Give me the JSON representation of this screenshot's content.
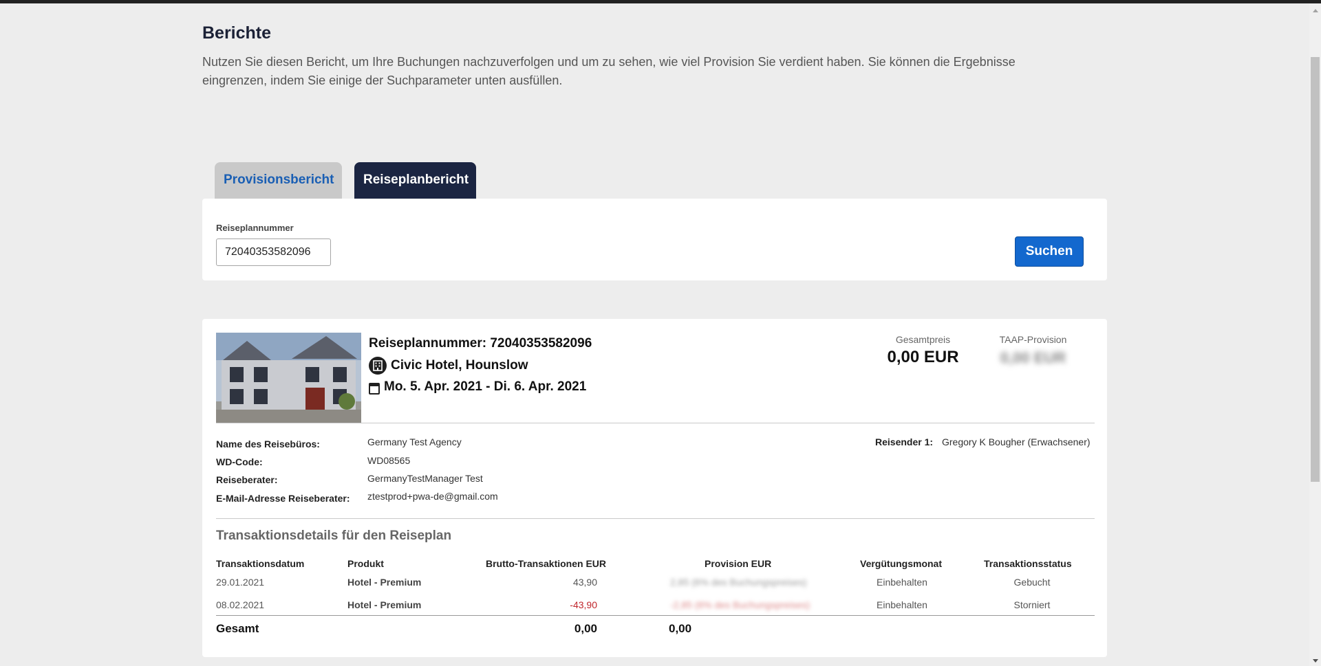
{
  "page": {
    "title": "Berichte",
    "description": "Nutzen Sie diesen Bericht, um Ihre Buchungen nachzuverfolgen und um zu sehen, wie viel Provision Sie verdient haben. Sie können die Ergebnisse eingrenzen, indem Sie einige der Suchparameter unten ausfüllen."
  },
  "tabs": [
    {
      "label": "Provisionsbericht",
      "active": false
    },
    {
      "label": "Reiseplanbericht",
      "active": true
    }
  ],
  "search": {
    "label": "Reiseplannummer",
    "value": "72040353582096",
    "button_label": "Suchen"
  },
  "result": {
    "itinerary_number": "Reiseplannummer: 72040353582096",
    "hotel": "Civic Hotel, Hounslow",
    "dates": "Mo. 5. Apr. 2021 - Di. 6. Apr. 2021",
    "total_price_label": "Gesamtpreis",
    "total_price_value": "0,00 EUR",
    "taap_label": "TAAP-Provision",
    "taap_value": "0,00 EUR",
    "agency_label": "Name des Reisebüros:",
    "agency_value": "Germany Test Agency",
    "wd_label": "WD-Code:",
    "wd_value": "WD08565",
    "advisor_label": "Reiseberater:",
    "advisor_value": "GermanyTestManager Test",
    "email_label": "E-Mail-Adresse Reiseberater:",
    "email_value": "ztestprod+pwa-de@gmail.com",
    "traveler_label": "Reisender 1:",
    "traveler_value": "Gregory K Bougher (Erwachsener)"
  },
  "transactions": {
    "title": "Transaktionsdetails für den Reiseplan",
    "headers": {
      "date": "Transaktionsdatum",
      "product": "Produkt",
      "gross": "Brutto-Transaktionen EUR",
      "commission": "Provision EUR",
      "month": "Vergütungsmonat",
      "status": "Transaktionsstatus"
    },
    "rows": [
      {
        "date": "29.01.2021",
        "product": "Hotel - Premium",
        "gross": "43,90",
        "commission": "2,85 (6% des Buchungspreises)",
        "month": "Einbehalten",
        "status": "Gebucht"
      },
      {
        "date": "08.02.2021",
        "product": "Hotel - Premium",
        "gross": "-43,90",
        "commission": "-2,85 (6% des Buchungspreises)",
        "month": "Einbehalten",
        "status": "Storniert"
      }
    ],
    "total_label": "Gesamt",
    "total_gross": "0,00",
    "total_commission": "0,00"
  }
}
